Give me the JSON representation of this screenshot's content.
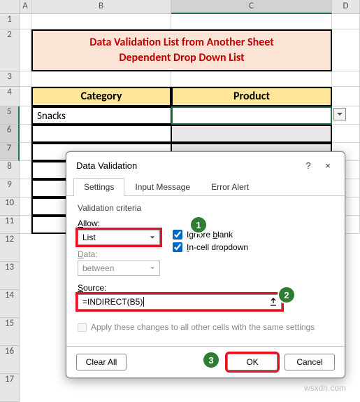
{
  "columns": [
    "A",
    "B",
    "C",
    "D"
  ],
  "rows": [
    "1",
    "2",
    "3",
    "4",
    "5",
    "6",
    "7",
    "8",
    "9",
    "10",
    "11",
    "12",
    "13",
    "14",
    "15",
    "16",
    "17"
  ],
  "title": {
    "line1": "Data Validation List from Another Sheet",
    "line2": "Dependent Drop Down List"
  },
  "table": {
    "headers": {
      "category": "Category",
      "product": "Product"
    },
    "rows": [
      {
        "category": "Snacks",
        "product": ""
      },
      {
        "category": "",
        "product": ""
      },
      {
        "category": "",
        "product": ""
      },
      {
        "category": "",
        "product": ""
      },
      {
        "category": "",
        "product": ""
      },
      {
        "category": "",
        "product": ""
      },
      {
        "category": "",
        "product": ""
      }
    ]
  },
  "dialog": {
    "title": "Data Validation",
    "help": "?",
    "close": "×",
    "tabs": {
      "settings": "Settings",
      "input_message": "Input Message",
      "error_alert": "Error Alert"
    },
    "criteria_label": "Validation criteria",
    "allow": {
      "label_pre": "",
      "label": "Allow:",
      "value": "List"
    },
    "ignore_blank": {
      "label_pre": "Ignore ",
      "label_u": "b",
      "label_post": "lank",
      "checked": true
    },
    "incell_dropdown": {
      "label_pre": "",
      "label_u": "I",
      "label_post": "n-cell dropdown",
      "checked": true
    },
    "data": {
      "label": "Data:",
      "value": "between"
    },
    "source": {
      "label": "Source:",
      "value": "=INDIRECT(B5)"
    },
    "apply_changes": "Apply these changes to all other cells with the same settings",
    "buttons": {
      "clear_all": "Clear All",
      "ok": "OK",
      "cancel": "Cancel"
    },
    "badges": {
      "one": "1",
      "two": "2",
      "three": "3"
    }
  },
  "watermark": "wsxdn.com",
  "chart_data": null
}
